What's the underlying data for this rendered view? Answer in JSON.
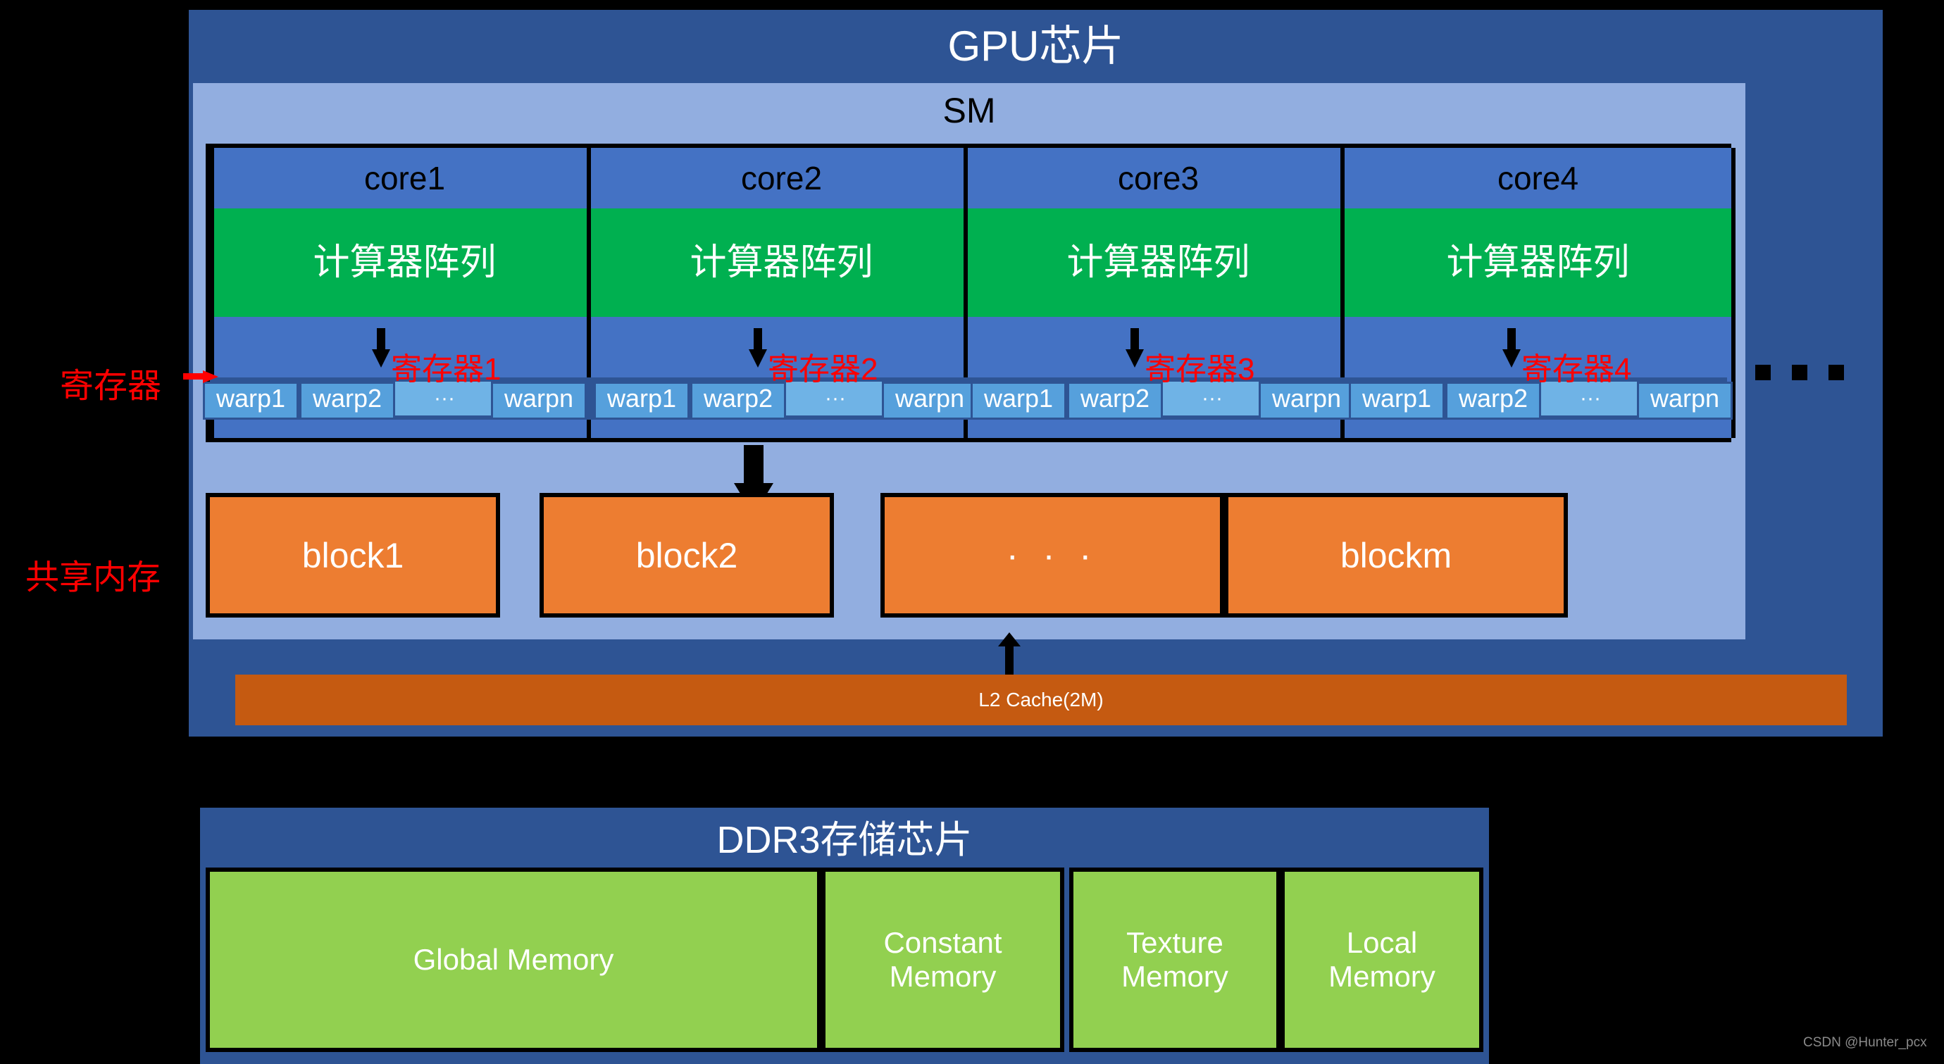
{
  "gpu_chip": {
    "title": "GPU芯片",
    "sm": {
      "title": "SM",
      "cores": [
        {
          "name": "core1",
          "compute_label": "计算器阵列",
          "register_label": "寄存器1",
          "warps": [
            "warp1",
            "warp2",
            "warpn"
          ],
          "warp_ellipsis": "···"
        },
        {
          "name": "core2",
          "compute_label": "计算器阵列",
          "register_label": "寄存器2",
          "warps": [
            "warp1",
            "warp2",
            "warpn"
          ],
          "warp_ellipsis": "···"
        },
        {
          "name": "core3",
          "compute_label": "计算器阵列",
          "register_label": "寄存器3",
          "warps": [
            "warp1",
            "warp2",
            "warpn"
          ],
          "warp_ellipsis": "···"
        },
        {
          "name": "core4",
          "compute_label": "计算器阵列",
          "register_label": "寄存器4",
          "warps": [
            "warp1",
            "warp2",
            "warpn"
          ],
          "warp_ellipsis": "···"
        }
      ],
      "blocks": [
        {
          "label": "block1"
        },
        {
          "label": "block2"
        },
        {
          "label": "· · ·"
        },
        {
          "label": "blockm"
        }
      ]
    },
    "l2_cache": "L2 Cache(2M)"
  },
  "ddr_chip": {
    "title": "DDR3存储芯片",
    "memories": [
      {
        "label": "Global Memory"
      },
      {
        "label": "Constant\nMemory"
      },
      {
        "label": "Texture\nMemory"
      },
      {
        "label": "Local\nMemory"
      }
    ]
  },
  "annotations": {
    "register_side_label": "寄存器",
    "shared_memory_side_label": "共享内存",
    "more_cores_ellipsis": "···"
  },
  "watermark": "CSDN @Hunter_pcx",
  "colors": {
    "chip_blue": "#2E5494",
    "sm_blue": "#92AEE0",
    "core_blue": "#4472C4",
    "compute_green": "#00B050",
    "warp_blue": "#56A0DC",
    "block_orange": "#ED7D31",
    "l2_orange": "#C55A11",
    "memory_green": "#92D050",
    "annotation_red": "#FF0000"
  }
}
